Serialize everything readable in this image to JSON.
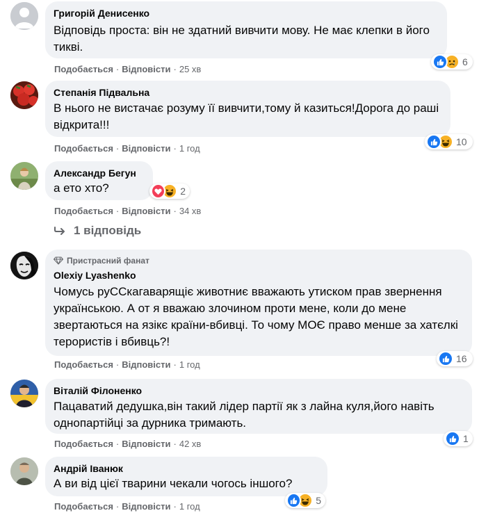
{
  "actions": {
    "like": "Подобається",
    "reply": "Відповісти",
    "sep": "·"
  },
  "comments": [
    {
      "author": "Григорій Денисенко",
      "text": "Відповідь проста: він не здатний вивчити мову. Не має клепки в його тикві.",
      "time": "25 хв",
      "reaction_count": "6",
      "reactions": [
        "like-icon",
        "sad-icon"
      ],
      "avatar": "default"
    },
    {
      "author": "Степанія Підвальна",
      "text": "В нього не вистачає розуму її вивчити,тому й казиться!Дорога до раші відкрита!!!",
      "time": "1 год",
      "reaction_count": "10",
      "reactions": [
        "like-icon",
        "haha-icon"
      ],
      "avatar": "strawberries"
    },
    {
      "author": "Александр Бегун",
      "text": "а ето хто?",
      "time": "34 хв",
      "reaction_count": "2",
      "reactions": [
        "love-icon",
        "haha-icon"
      ],
      "avatar": "person"
    },
    {
      "badge": "Пристрасний фанат",
      "author": "Olexiy Lyashenko",
      "text": "Чомусь руССкагаварящіє животниє вважають утиском прав звернення українською. А от я вважаю злочином проти мене, коли до мене звертаються на язікє країни-вбивці. То чому МОЄ право менше за хатєлкі терористів і вбивць?!",
      "time": "1 год",
      "reaction_count": "16",
      "reactions": [
        "like-icon"
      ],
      "avatar": "mask"
    },
    {
      "author": "Віталій Філоненко",
      "text": "Пацаватий дедушка,він такий лідер партії як з лайна куля,його навіть однопартійці за дурника тримають.",
      "time": "42 хв",
      "reaction_count": "1",
      "reactions": [
        "like-icon"
      ],
      "avatar": "person-yellow"
    },
    {
      "author": "Андрій Іванюк",
      "text": "А ви від цієї тварини чекали чогось іншого?",
      "time": "1 год",
      "reaction_count": "5",
      "reactions": [
        "like-icon",
        "haha-icon"
      ],
      "avatar": "person-gray"
    }
  ],
  "replies_link": "1 відповідь",
  "colors": {
    "bubble": "#f0f2f5",
    "meta": "#65676b",
    "like": "#1877f2",
    "love": "#f33e58",
    "emoji": "#f7b125"
  }
}
